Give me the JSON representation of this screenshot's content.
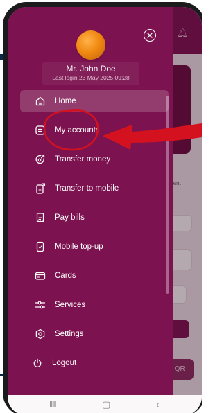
{
  "app": {
    "brand_color": "#7c1350",
    "annotation_color": "#d4111e"
  },
  "user": {
    "name": "Mr. John Doe",
    "last_login": "Last login 23 May 2025 09:28"
  },
  "menu": {
    "items": [
      {
        "label": "Home",
        "icon": "home-icon",
        "active": true
      },
      {
        "label": "My accounts",
        "icon": "wallet-icon",
        "active": false
      },
      {
        "label": "Transfer money",
        "icon": "transfer-icon",
        "active": false
      },
      {
        "label": "Transfer to mobile",
        "icon": "phone-transfer-icon",
        "active": false
      },
      {
        "label": "Pay bills",
        "icon": "receipt-icon",
        "active": false
      },
      {
        "label": "Mobile top-up",
        "icon": "mobile-topup-icon",
        "active": false
      },
      {
        "label": "Cards",
        "icon": "card-icon",
        "active": false
      },
      {
        "label": "Services",
        "icon": "sliders-icon",
        "active": false
      },
      {
        "label": "Settings",
        "icon": "gear-icon",
        "active": false
      },
      {
        "label": "Logout",
        "icon": "power-icon",
        "active": false
      }
    ]
  },
  "background": {
    "partial_text": "ment",
    "qr_button_text": "n QR"
  }
}
